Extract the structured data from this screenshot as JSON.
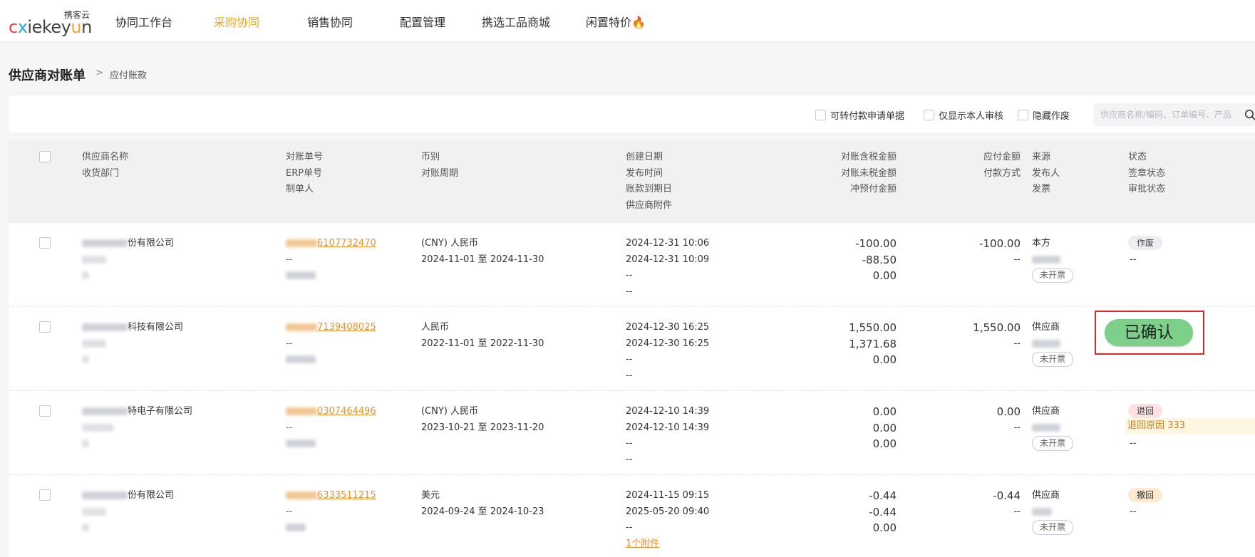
{
  "brand": {
    "cn": "携客云",
    "en": "xiekeyun"
  },
  "nav": {
    "items": [
      "协同工作台",
      "采购协同",
      "销售协同",
      "配置管理",
      "携选工品商城",
      "闲置特价"
    ],
    "active_index": 1,
    "flame": "🔥"
  },
  "breadcrumb": {
    "title": "供应商对账单",
    "separator": ">",
    "current": "应付账款"
  },
  "filters": {
    "checkboxes": [
      "可转付款申请单据",
      "仅显示本人审核",
      "隐藏作废"
    ],
    "search_placeholder": "供应商名称/编码、订单编号、产品"
  },
  "table": {
    "headers": {
      "supplier": [
        "供应商名称",
        "收货部门"
      ],
      "bill": [
        "对账单号",
        "ERP单号",
        "制单人"
      ],
      "currency": [
        "币别",
        "对账周期"
      ],
      "dates": [
        "创建日期",
        "发布时间",
        "账款到期日",
        "供应商附件"
      ],
      "amounts": [
        "对账含税金额",
        "对账未税金额",
        "冲预付金额"
      ],
      "payable": [
        "应付金额",
        "付款方式"
      ],
      "source": [
        "来源",
        "发布人",
        "发票"
      ],
      "status": [
        "状态",
        "签章状态",
        "审批状态"
      ]
    },
    "rows": [
      {
        "supplier_suffix": "份有限公司",
        "bill_suffix": "6107732470",
        "erp": "--",
        "currency": "(CNY) 人民币",
        "period": "2024-11-01 至 2024-11-30",
        "created": "2024-12-31 10:06",
        "published": "2024-12-31 10:09",
        "due": "--",
        "attachment": "--",
        "tax_amount": "-100.00",
        "untaxed_amount": "-88.50",
        "prepaid_offset": "0.00",
        "payable": "-100.00",
        "pay_method": "--",
        "source": "本方",
        "invoice": "未开票",
        "status": "作废",
        "status_style": "void",
        "approval": "--"
      },
      {
        "supplier_suffix": "科技有限公司",
        "bill_suffix": "7139408025",
        "erp": "--",
        "currency": "人民币",
        "period": "2022-11-01 至 2022-11-30",
        "created": "2024-12-30 16:25",
        "published": "2024-12-30 16:25",
        "due": "--",
        "attachment": "--",
        "tax_amount": "1,550.00",
        "untaxed_amount": "1,371.68",
        "prepaid_offset": "0.00",
        "payable": "1,550.00",
        "pay_method": "--",
        "source": "供应商",
        "invoice": "未开票",
        "status": "已确认",
        "status_style": "confirmed",
        "approval": ""
      },
      {
        "supplier_suffix": "特电子有限公司",
        "bill_suffix": "0307464496",
        "erp": "--",
        "currency": "(CNY) 人民币",
        "period": "2023-10-21 至 2023-11-20",
        "created": "2024-12-10 14:39",
        "published": "2024-12-10 14:39",
        "due": "--",
        "attachment": "--",
        "tax_amount": "0.00",
        "untaxed_amount": "0.00",
        "prepaid_offset": "0.00",
        "payable": "0.00",
        "pay_method": "--",
        "source": "供应商",
        "invoice": "未开票",
        "status": "退回",
        "status_style": "return",
        "reason": "退回原因 333",
        "approval": "--"
      },
      {
        "supplier_suffix": "份有限公司",
        "bill_suffix": "6333511215",
        "erp": "--",
        "currency": "美元",
        "period": "2024-09-24 至 2024-10-23",
        "created": "2024-11-15 09:15",
        "published": "2025-05-20 09:40",
        "due": "--",
        "attachment": "1个附件",
        "tax_amount": "-0.44",
        "untaxed_amount": "-0.44",
        "prepaid_offset": "0.00",
        "payable": "-0.44",
        "pay_method": "--",
        "source": "供应商",
        "invoice": "未开票",
        "status": "撤回",
        "status_style": "revoke",
        "approval": "--"
      }
    ]
  },
  "colors": {
    "accent": "#f5a623",
    "link": "#e8912c",
    "highlight_border": "#e2262b",
    "confirmed": "#7dd08a"
  },
  "icons": [
    "search-icon",
    "flame-icon"
  ]
}
